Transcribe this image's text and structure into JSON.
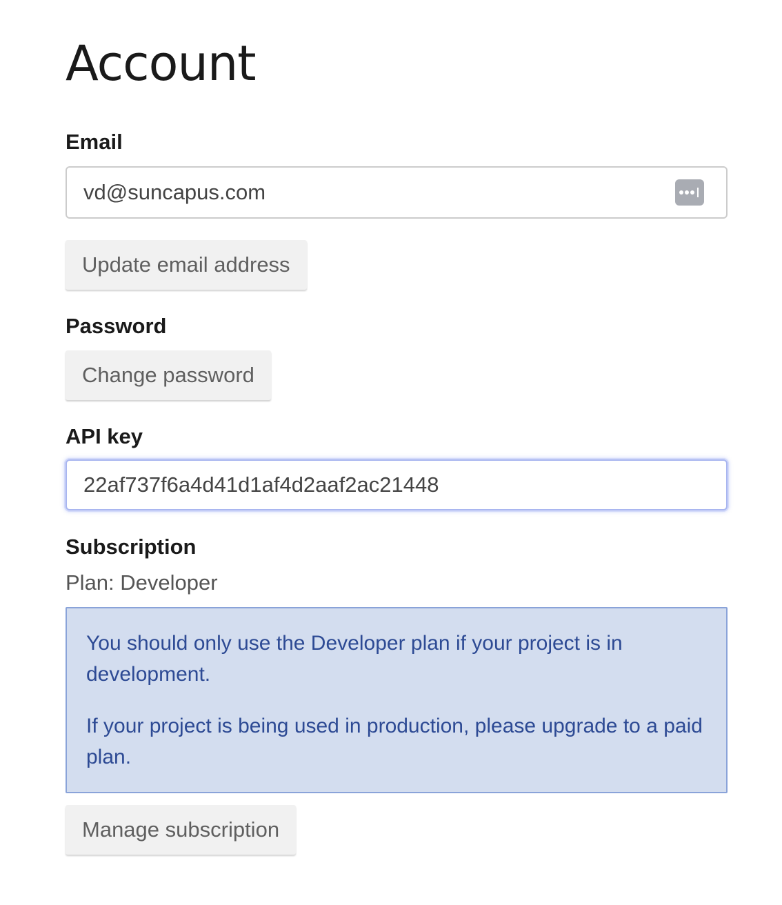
{
  "page": {
    "title": "Account"
  },
  "email": {
    "label": "Email",
    "value": "vd@suncapus.com",
    "icon": "password-manager-icon",
    "update_button": "Update email address"
  },
  "password": {
    "label": "Password",
    "change_button": "Change password"
  },
  "api_key": {
    "label": "API key",
    "value": "22af737f6a4d41d1af4d2aaf2ac21448"
  },
  "subscription": {
    "label": "Subscription",
    "plan_text": "Plan: Developer",
    "notice": {
      "line1": "You should only use the Developer plan if your project is in development.",
      "line2": "If your project is being used in production, please upgrade to a paid plan."
    },
    "manage_button": "Manage subscription"
  },
  "colors": {
    "notice_background": "#d3ddef",
    "notice_border": "#8aa3d9",
    "notice_text": "#2d4a94",
    "button_background": "#f1f1f1",
    "focus_ring": "#a9b6f0"
  }
}
